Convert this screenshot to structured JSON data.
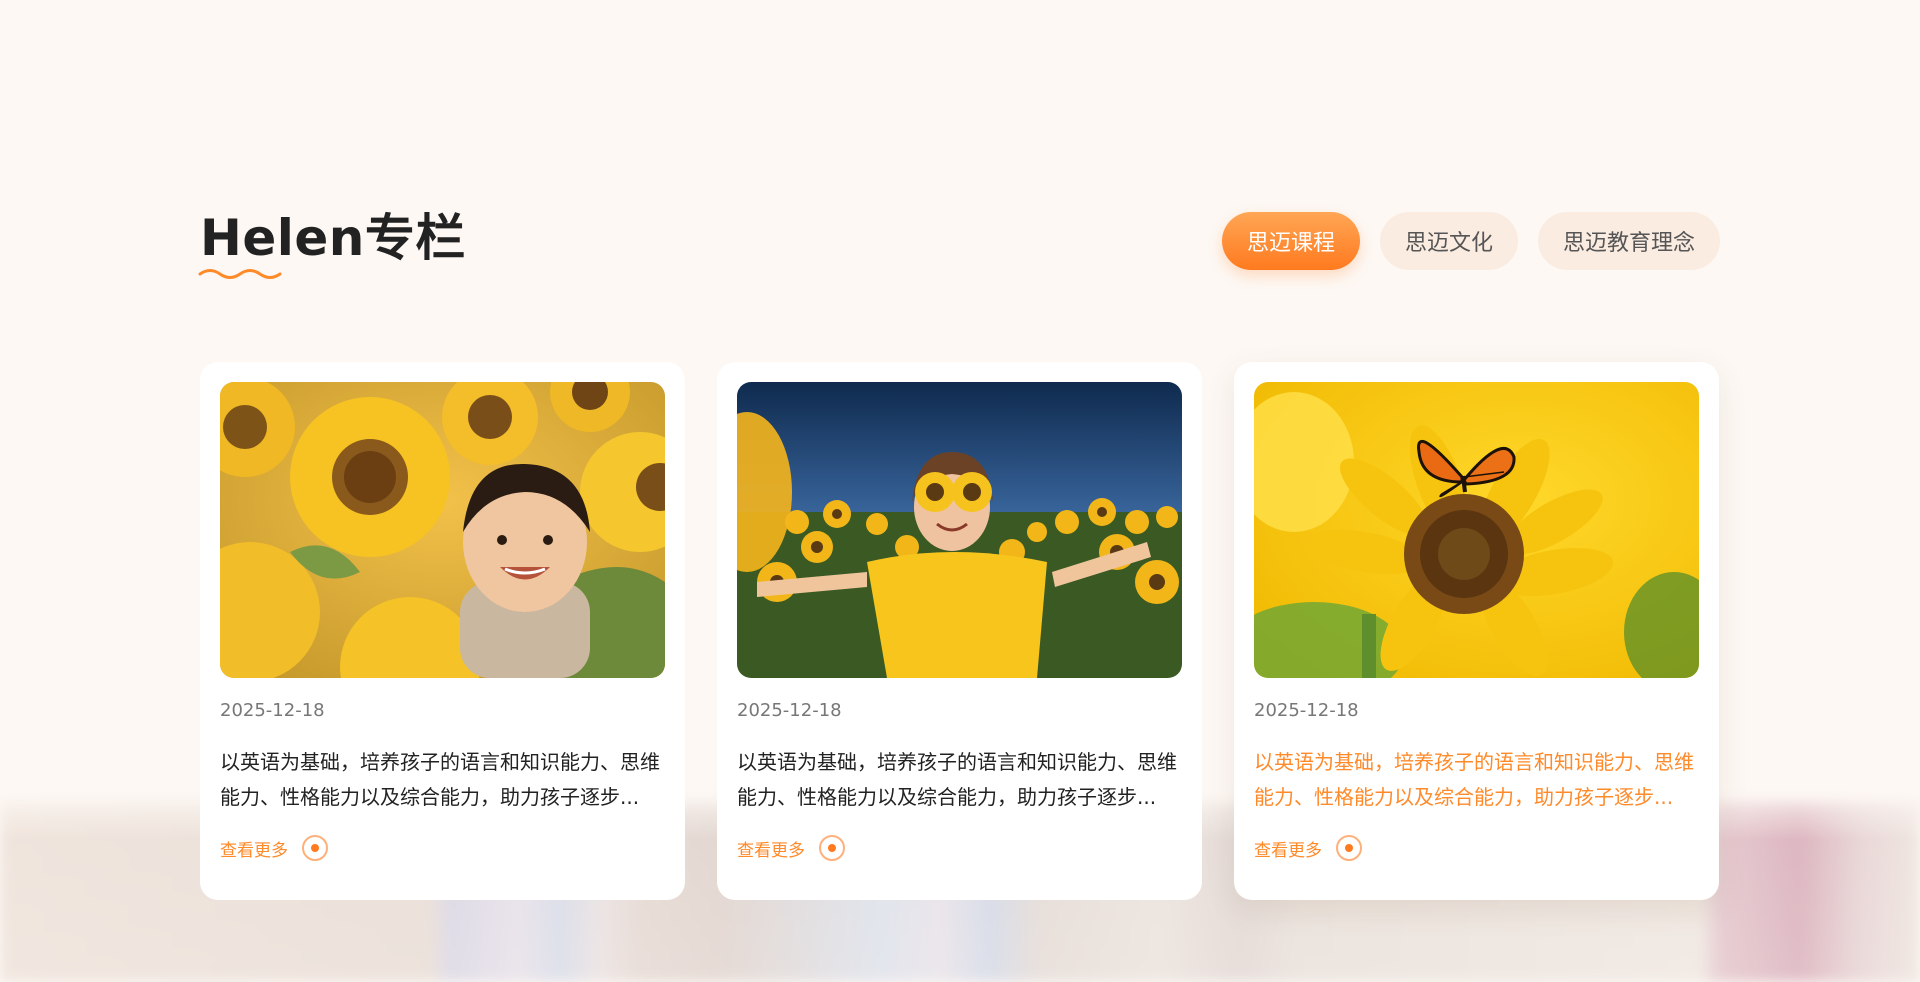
{
  "section": {
    "title": "Helen专栏"
  },
  "tabs": [
    {
      "label": "思迈课程",
      "active": true
    },
    {
      "label": "思迈文化",
      "active": false
    },
    {
      "label": "思迈教育理念",
      "active": false
    }
  ],
  "cards": [
    {
      "image": "child-smiling-among-sunflowers",
      "date": "2025-12-18",
      "description": "以英语为基础，培养孩子的语言和知识能力、思维能力、性格能力以及综合能力，助力孩子逐步...",
      "more_label": "查看更多"
    },
    {
      "image": "girl-with-sunflower-glasses-in-field",
      "date": "2025-12-18",
      "description": "以英语为基础，培养孩子的语言和知识能力、思维能力、性格能力以及综合能力，助力孩子逐步...",
      "more_label": "查看更多"
    },
    {
      "image": "butterfly-on-sunflower",
      "date": "2025-12-18",
      "description": "以英语为基础，培养孩子的语言和知识能力、思维能力、性格能力以及综合能力，助力孩子逐步...",
      "more_label": "查看更多"
    }
  ],
  "colors": {
    "accent": "#ff7a1f",
    "accent_light": "#ffa655",
    "tab_inactive_bg": "#fbece2",
    "page_bg": "#fdf8f4"
  }
}
